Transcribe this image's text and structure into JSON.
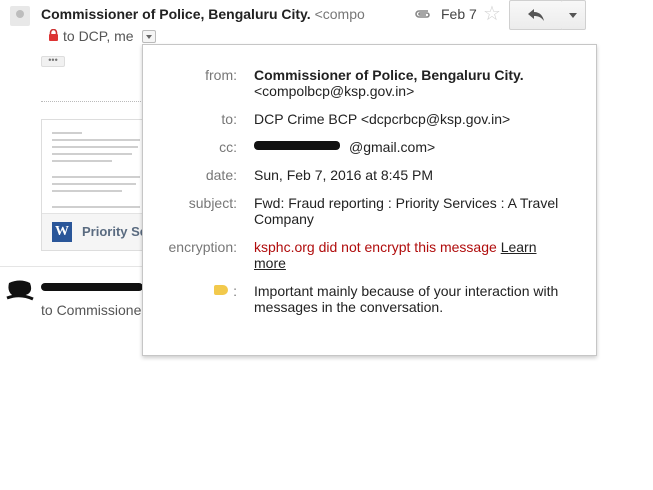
{
  "header": {
    "sender_name": "Commissioner of Police, Bengaluru City.",
    "sender_addr_short": "<compo",
    "to_line": "to DCP, me",
    "date": "Feb 7"
  },
  "attachment": {
    "name": "Priority Se"
  },
  "second_message": {
    "to_line": "to Commissione"
  },
  "details": {
    "from_label": "from:",
    "from_name": "Commissioner of Police, Bengaluru City.",
    "from_addr": "<compolbcp@ksp.gov.in>",
    "to_label": "to:",
    "to_value": "DCP Crime BCP <dcpcrbcp@ksp.gov.in>",
    "cc_label": "cc:",
    "cc_value": "@gmail.com>",
    "date_label": "date:",
    "date_value": "Sun, Feb 7, 2016 at 8:45 PM",
    "subject_label": "subject:",
    "subject_value": "Fwd: Fraud reporting : Priority Services : A Travel Company",
    "encryption_label": "encryption:",
    "encryption_value": "ksphc.org did not encrypt this message",
    "encryption_link": "Learn more",
    "importance_label": ":",
    "importance_value": "Important mainly because of your interaction with messages in the conversation."
  },
  "colors": {
    "warning": "#b00c0c",
    "important_tag": "#f2c94c",
    "word_icon": "#2a5699"
  },
  "icons": [
    "lock-icon",
    "details-chevron-icon",
    "paperclip-icon",
    "star-icon",
    "reply-icon",
    "more-chevron-icon",
    "word-icon",
    "important-label-icon"
  ]
}
